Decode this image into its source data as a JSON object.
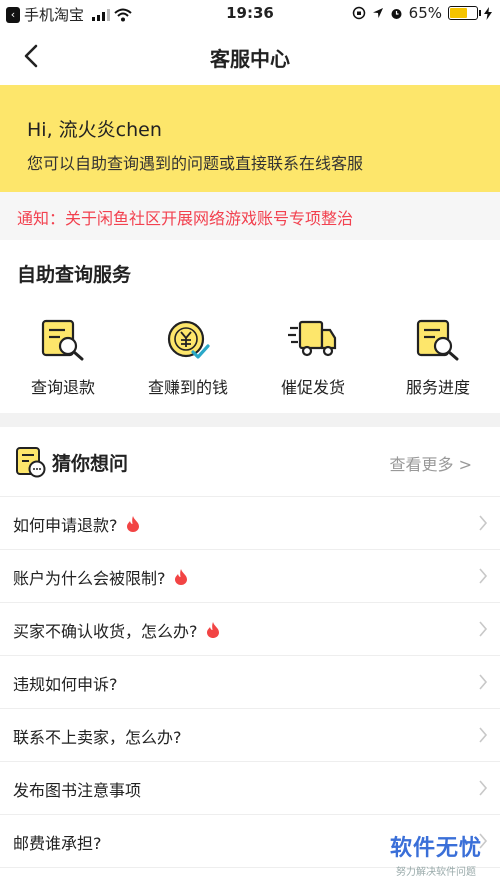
{
  "status_bar": {
    "carrier": "手机淘宝",
    "time": "19:36",
    "battery_percent": "65%",
    "battery_level": 0.65
  },
  "nav": {
    "title": "客服中心",
    "back_icon": "chevron-left-icon"
  },
  "banner": {
    "greeting": "Hi, 流火炎chen",
    "subtitle": "您可以自助查询遇到的问题或直接联系在线客服"
  },
  "notice": {
    "text": "通知：关于闲鱼社区开展网络游戏账号专项整治"
  },
  "self_service": {
    "title": "自助查询服务",
    "items": [
      {
        "label": "查询退款",
        "icon": "refund-search-icon"
      },
      {
        "label": "查赚到的钱",
        "icon": "yen-coin-icon"
      },
      {
        "label": "催促发货",
        "icon": "delivery-truck-icon"
      },
      {
        "label": "服务进度",
        "icon": "progress-search-icon"
      }
    ]
  },
  "guess": {
    "title": "猜你想问",
    "more_label": "查看更多 >",
    "questions": [
      {
        "text": "如何申请退款?",
        "hot": true
      },
      {
        "text": "账户为什么会被限制?",
        "hot": true
      },
      {
        "text": "买家不确认收货，怎么办?",
        "hot": true
      },
      {
        "text": "违规如何申诉?",
        "hot": false
      },
      {
        "text": "联系不上卖家，怎么办?",
        "hot": false
      },
      {
        "text": "发布图书注意事项",
        "hot": false
      },
      {
        "text": "邮费谁承担?",
        "hot": false
      }
    ]
  },
  "watermark": {
    "main": "软件无忧",
    "sub": "努力解决软件问题"
  },
  "colors": {
    "accent_yellow": "#fde66b",
    "notice_red": "#f2414f",
    "hot_red": "#f24444"
  }
}
